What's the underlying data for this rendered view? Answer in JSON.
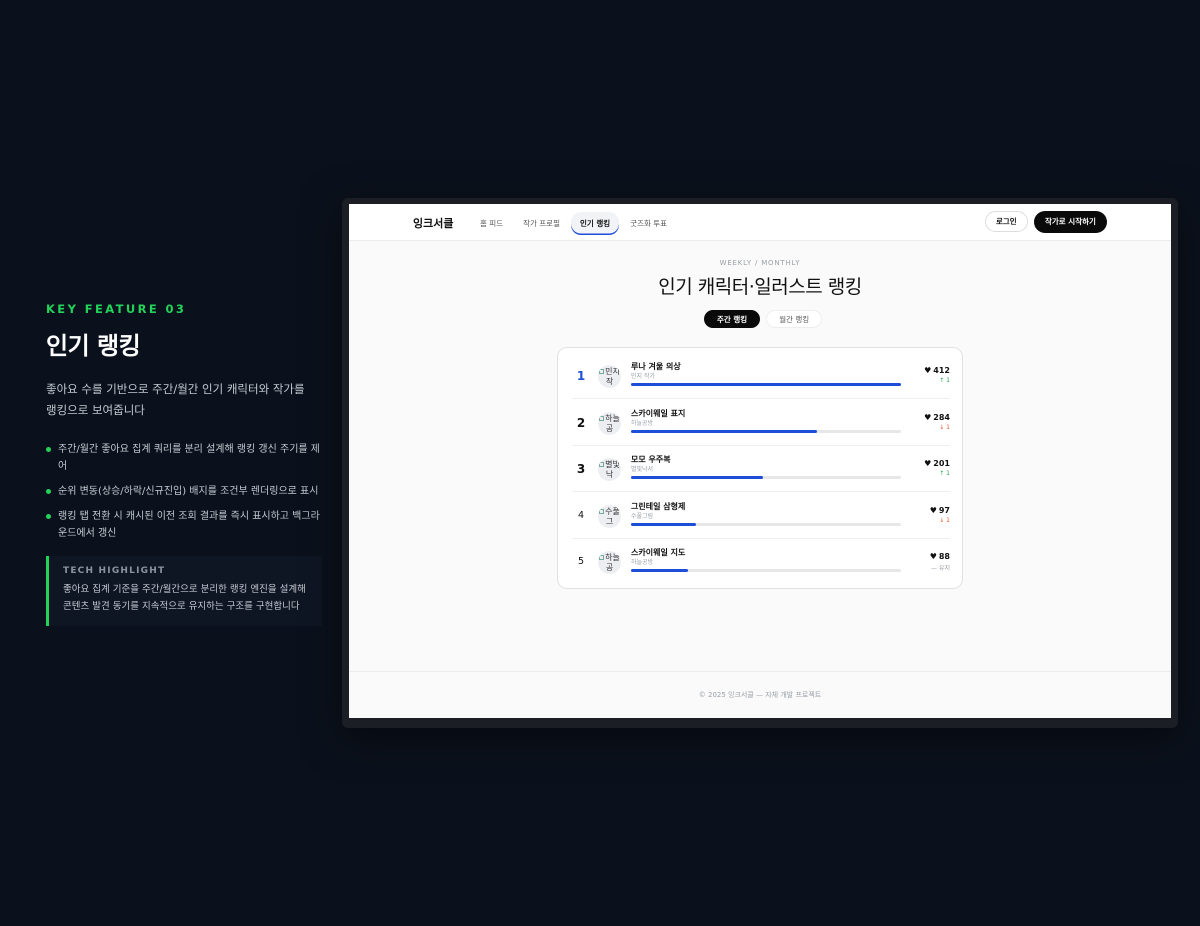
{
  "feature": {
    "kicker": "KEY FEATURE 03",
    "title": "인기 랭킹",
    "description": "좋아요 수를 기반으로 주간/월간 인기 캐릭터와 작가를 랭킹으로 보여줍니다",
    "bullets": [
      "주간/월간 좋아요 집계 쿼리를 분리 설계해 랭킹 갱신 주기를 제어",
      "순위 변동(상승/하락/신규진입) 배지를 조건부 렌더링으로 표시",
      "랭킹 탭 전환 시 캐시된 이전 조회 결과를 즉시 표시하고 백그라운드에서 갱신"
    ],
    "tech_highlight": {
      "label": "TECH HIGHLIGHT",
      "body": "좋아요 집계 기준을 주간/월간으로 분리한 랭킹 엔진을 설계해 콘텐츠 발견 동기를 지속적으로 유지하는 구조를 구현합니다"
    }
  },
  "nav": {
    "logo": "잉크서클",
    "menu": [
      "홈 피드",
      "작가 프로필",
      "인기 랭킹",
      "굿즈화 투표"
    ],
    "active_menu": "인기 랭킹",
    "login": "로그인",
    "start": "작가로 시작하기"
  },
  "hero": {
    "eyebrow": "WEEKLY / MONTHLY",
    "title": "인기 캐릭터·일러스트 랭킹",
    "tabs": [
      "주간 랭킹",
      "월간 랭킹"
    ],
    "active_tab": "주간 랭킹"
  },
  "ranking": [
    {
      "rank": "1",
      "avatar_alt": "민지 작",
      "title": "루나 겨울 의상",
      "artist": "민지 작가",
      "likes": "412",
      "change": "↑ 1",
      "trend": "up",
      "progress": 1.0
    },
    {
      "rank": "2",
      "avatar_alt": "하늘공",
      "title": "스카이웨일 표지",
      "artist": "하늘공방",
      "likes": "284",
      "change": "↓ 1",
      "trend": "down",
      "progress": 0.69
    },
    {
      "rank": "3",
      "avatar_alt": "별빛낙",
      "title": "모모 우주복",
      "artist": "별빛낙서",
      "likes": "201",
      "change": "↑ 1",
      "trend": "up",
      "progress": 0.49
    },
    {
      "rank": "4",
      "avatar_alt": "수풀그",
      "title": "그린테일 삼형제",
      "artist": "수풀그림",
      "likes": "97",
      "change": "↓ 1",
      "trend": "down",
      "progress": 0.24
    },
    {
      "rank": "5",
      "avatar_alt": "하늘공",
      "title": "스카이웨일 지도",
      "artist": "하늘공방",
      "likes": "88",
      "change": "— 유지",
      "trend": "same",
      "progress": 0.21
    }
  ],
  "footer": "© 2025 잉크서클 — 자체 개발 프로젝트",
  "colors": {
    "accent": "#22d35a",
    "bar": "#1d4ed8",
    "up": "#22a55a",
    "down": "#e4572e",
    "background": "#0b111c"
  }
}
